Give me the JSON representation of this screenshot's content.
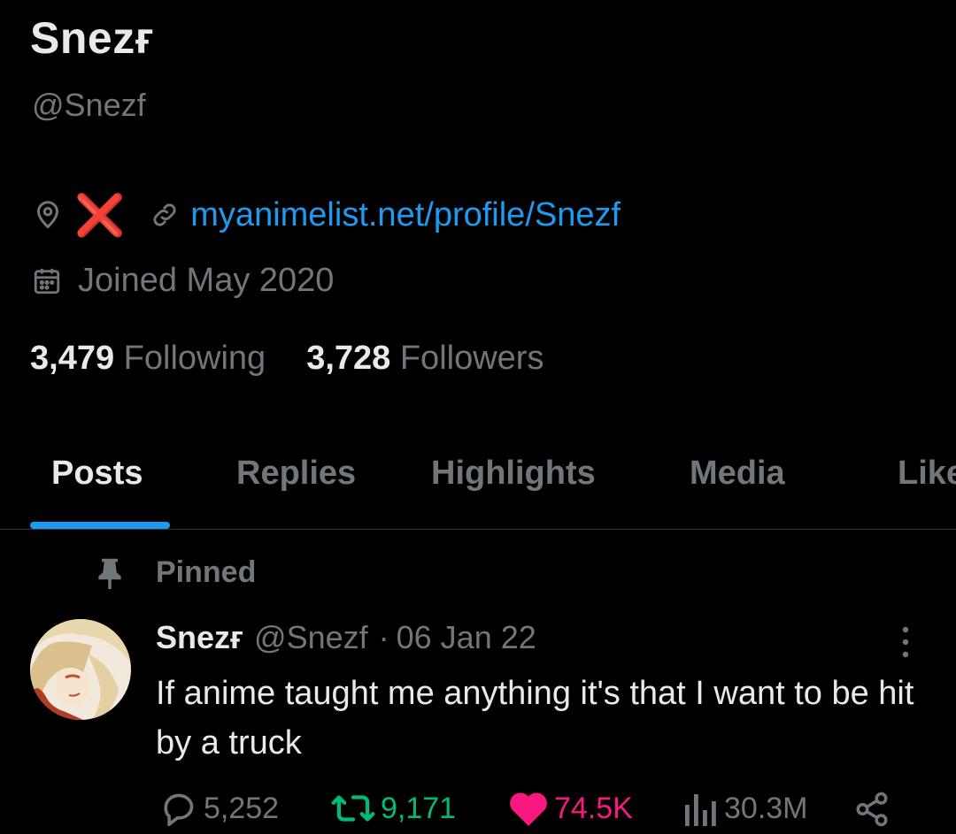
{
  "profile": {
    "name": "Snezғ",
    "handle": "@Snezf",
    "location": "❌",
    "website": "myanimelist.net/profile/Snezf",
    "joined": "Joined May 2020",
    "following_count": "3,479",
    "following_label": "Following",
    "followers_count": "3,728",
    "followers_label": "Followers"
  },
  "tabs": [
    {
      "label": "Posts",
      "active": true
    },
    {
      "label": "Replies"
    },
    {
      "label": "Highlights"
    },
    {
      "label": "Media"
    },
    {
      "label": "Likes"
    }
  ],
  "pinned_label": "Pinned",
  "post": {
    "author": "Snezғ",
    "handle": "@Snezf",
    "separator": "·",
    "date": "06 Jan 22",
    "text": "If anime taught me anything it's that I want to be hit by a truck",
    "replies": "5,252",
    "reposts": "9,171",
    "likes": "74.5K",
    "views": "30.3M"
  },
  "colors": {
    "accent": "#1d9bf0",
    "muted": "#71767b",
    "repost": "#00ba7c",
    "like": "#f91880",
    "location_mark": "#e0201b"
  },
  "icons": [
    "location-icon",
    "link-icon",
    "calendar-icon",
    "pin-icon",
    "more-icon",
    "reply-icon",
    "repost-icon",
    "like-icon",
    "views-icon",
    "share-icon"
  ]
}
